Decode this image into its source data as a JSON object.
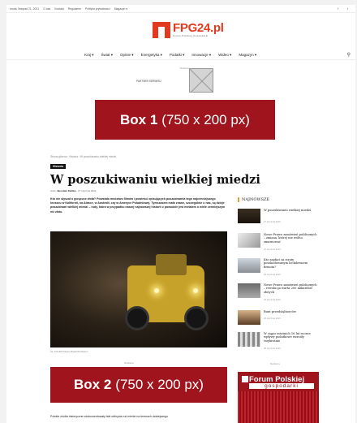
{
  "topbar": {
    "date": "środa, listopad 21, 2021",
    "links": [
      "O nas",
      "Kontakt",
      "Regulamin",
      "Polityka prywatności",
      "Magazyn ▾"
    ],
    "social": [
      "f",
      "t"
    ]
  },
  "brand": {
    "name": "FPG24.pl",
    "tagline": "Forum Polskiej Gospodarki"
  },
  "nav": {
    "items": [
      "Kraj ▾",
      "Świat ▾",
      "Opinie ▾",
      "Energetyka ▾",
      "Podatki ▾",
      "Innowacje ▾",
      "Wideo ▾",
      "Magazyn ▾"
    ],
    "search_icon": "search-icon"
  },
  "ads": {
    "label": "Reklama",
    "partner_label": "PARTNER SERWISU",
    "box1_bold": "Box 1",
    "box1_rest": "(750 x 200 px)",
    "box2_bold": "Box 2",
    "box2_rest": "(750 x 200 px)"
  },
  "article": {
    "breadcrumb": "Strona główna  ›  Historia  ›  W poszukiwaniu wielkiej miedzi",
    "category": "Historia",
    "title": "W poszukiwaniu wielkiej miedzi",
    "author_prefix": "Autor",
    "author": "Jarosław Kwitka",
    "date": "27 stycznia 2021",
    "lead": "Kto nie słyszał o gorączce złota? Powstało mnóstwo filmów i powieści opisujących poszukiwania tego najcenniejszego kruszcu w Kalifornii, na Alasce, w Australii, czy w Ameryce Południowej. Tymczasem mało znane, szczególnie u nas, są dzieje poszukiwań wielkiej miedzi – rudy, która w przypadku naszej najnowszej historii o powodzie jest metalem o wiele cenniejszym niż złoto.",
    "photo_caption": "fot. KGHM Polska Miedź/Archiwum",
    "body_start": "Polskie źródła historyczne udokumentowały fakt odkrycia rud miedzi na terenach dzisiejszego"
  },
  "sidebar": {
    "heading": "NAJNOWSZE",
    "items": [
      {
        "title": "W poszukiwaniu wielkiej miedzi",
        "date": "27 stycznia 2021"
      },
      {
        "title": "Nowe Prawo zamówień publicznych – zmiana, której nie wolno zmarnować",
        "date": "27 stycznia 2021"
      },
      {
        "title": "Kto zapłaci za straty poszkodowanym lockdownem firmom?",
        "date": "26 stycznia 2021"
      },
      {
        "title": "Nowe Prawo zamówień publicznych – rewolucja warta 200 miliardów złotych",
        "date": "26 stycznia 2021"
      },
      {
        "title": "Bunt przedsiębiorców",
        "date": "26 stycznia 2021"
      },
      {
        "title": "W ciągu ostatnich 16 lat roczne wpływy podatkowe wzrosły trzykrotnie",
        "date": "25 stycznia 2021"
      }
    ],
    "ad_label": "Reklama",
    "ad_line1": "Forum Polskiej",
    "ad_line2": "gospodarki"
  }
}
